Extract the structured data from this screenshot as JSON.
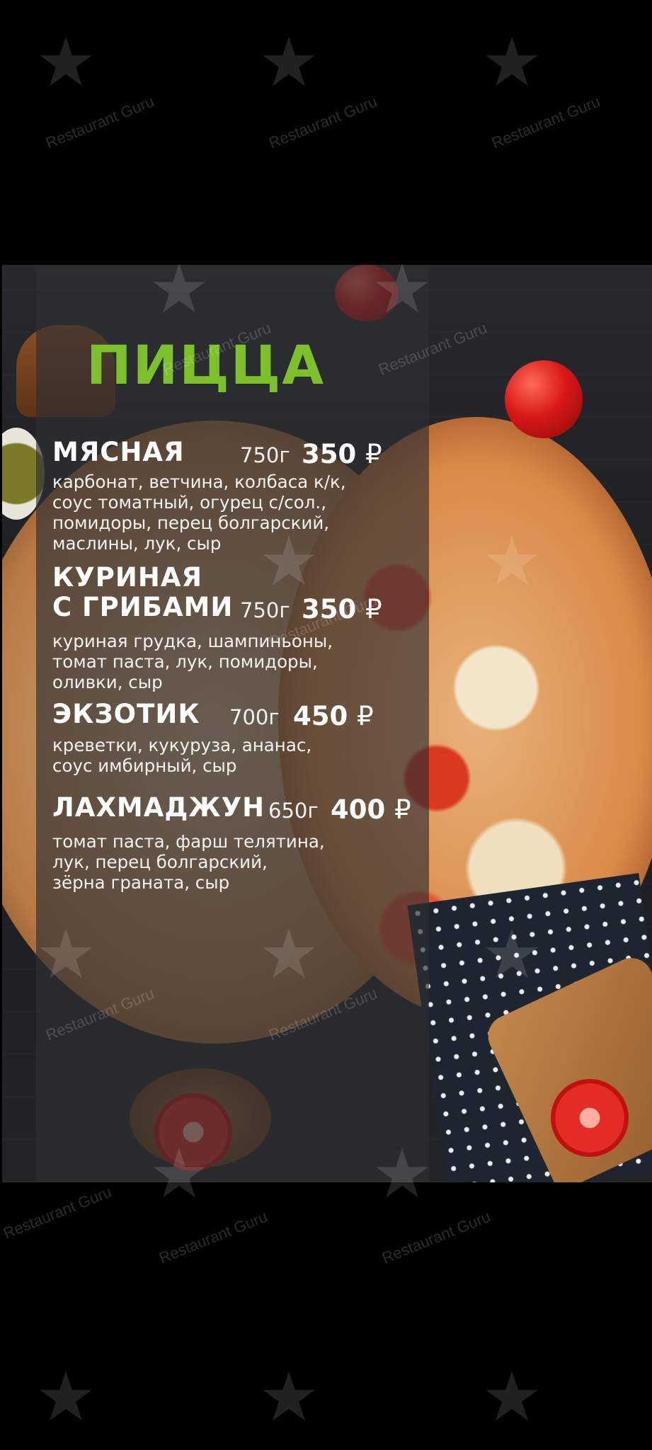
{
  "menu": {
    "title": "ПИЦЦА",
    "currency": "₽",
    "items": [
      {
        "name": [
          "МЯСНАЯ"
        ],
        "weight": "750г",
        "price": "350",
        "description": [
          "карбонат, ветчина, колбаса к/к,",
          "соус томатный, огурец с/сол.,",
          "помидоры, перец болгарский,",
          "маслины, лук, сыр"
        ]
      },
      {
        "name": [
          "КУРИНАЯ",
          "С ГРИБАМИ"
        ],
        "weight": "750г",
        "price": "350",
        "description": [
          "куриная грудка, шампиньоны,",
          "томат паста, лук, помидоры,",
          "оливки, сыр"
        ]
      },
      {
        "name": [
          "ЭКЗОТИК"
        ],
        "weight": "700г",
        "price": "450",
        "description": [
          "креветки, кукуруза, ананас,",
          "соус имбирный, сыр"
        ]
      },
      {
        "name": [
          "ЛАХМАДЖУН"
        ],
        "weight": "650г",
        "price": "400",
        "description": [
          "томат паста, фарш телятина,",
          "лук, перец болгарский,",
          "зёрна граната, сыр"
        ]
      }
    ]
  },
  "watermark": {
    "text": "Restaurant Guru",
    "icon": "fork-star-icon"
  },
  "colors": {
    "background": "#000000",
    "title_green": "#7cc12a",
    "panel": "#2d2f32",
    "text": "#ffffff"
  }
}
